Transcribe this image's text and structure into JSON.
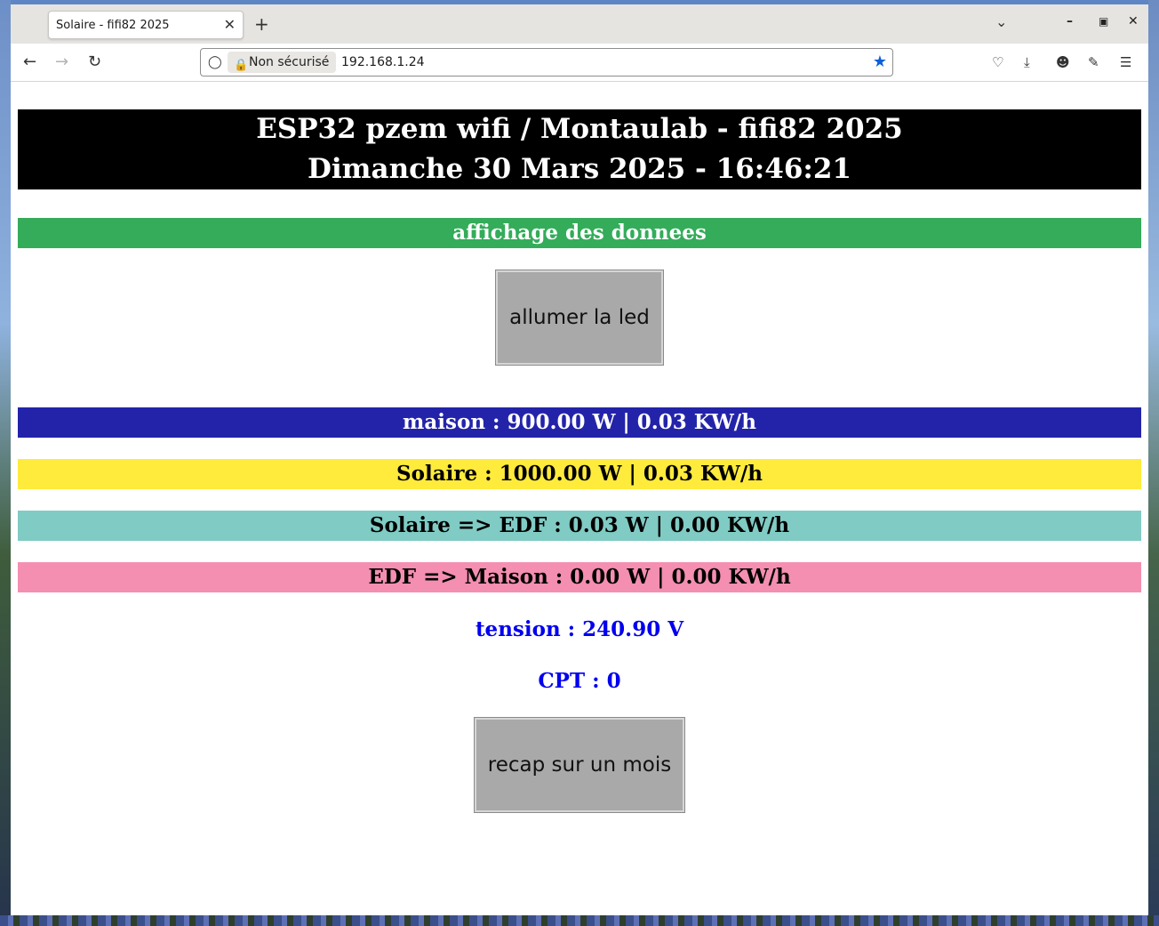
{
  "browser": {
    "tab_title": "Solaire - fifi82 2025",
    "tab_close": "✕",
    "new_tab": "+",
    "security_label": "Non sécurisé",
    "url": "192.168.1.24"
  },
  "page": {
    "header_line1": "ESP32 pzem wifi / Montaulab - fifi82 2025",
    "header_line2": "Dimanche 30 Mars 2025 - 16:46:21",
    "section_title": "affichage des donnees",
    "led_button": "allumer la led",
    "maison": "maison : 900.00 W | 0.03 KW/h",
    "solaire": "Solaire : 1000.00 W | 0.03 KW/h",
    "solaire_edf": "Solaire => EDF : 0.03 W | 0.00 KW/h",
    "edf_maison": "EDF => Maison : 0.00 W | 0.00 KW/h",
    "tension": "tension : 240.90 V",
    "cpt": "CPT : 0",
    "recap_button": "recap sur un mois"
  },
  "colors": {
    "header_bg": "#000000",
    "section_bg": "#34ac5a",
    "maison_bg": "#2323aa",
    "solaire_bg": "#ffeb3b",
    "solaire_edf_bg": "#80cbc4",
    "edf_maison_bg": "#f48fb1",
    "info_text": "#0000ee"
  },
  "icons": [
    "shield-icon",
    "lock-icon",
    "star-icon",
    "back-icon",
    "forward-icon",
    "reload-icon",
    "pocket-icon",
    "download-icon",
    "account-icon",
    "extensions-icon",
    "menu-icon"
  ]
}
